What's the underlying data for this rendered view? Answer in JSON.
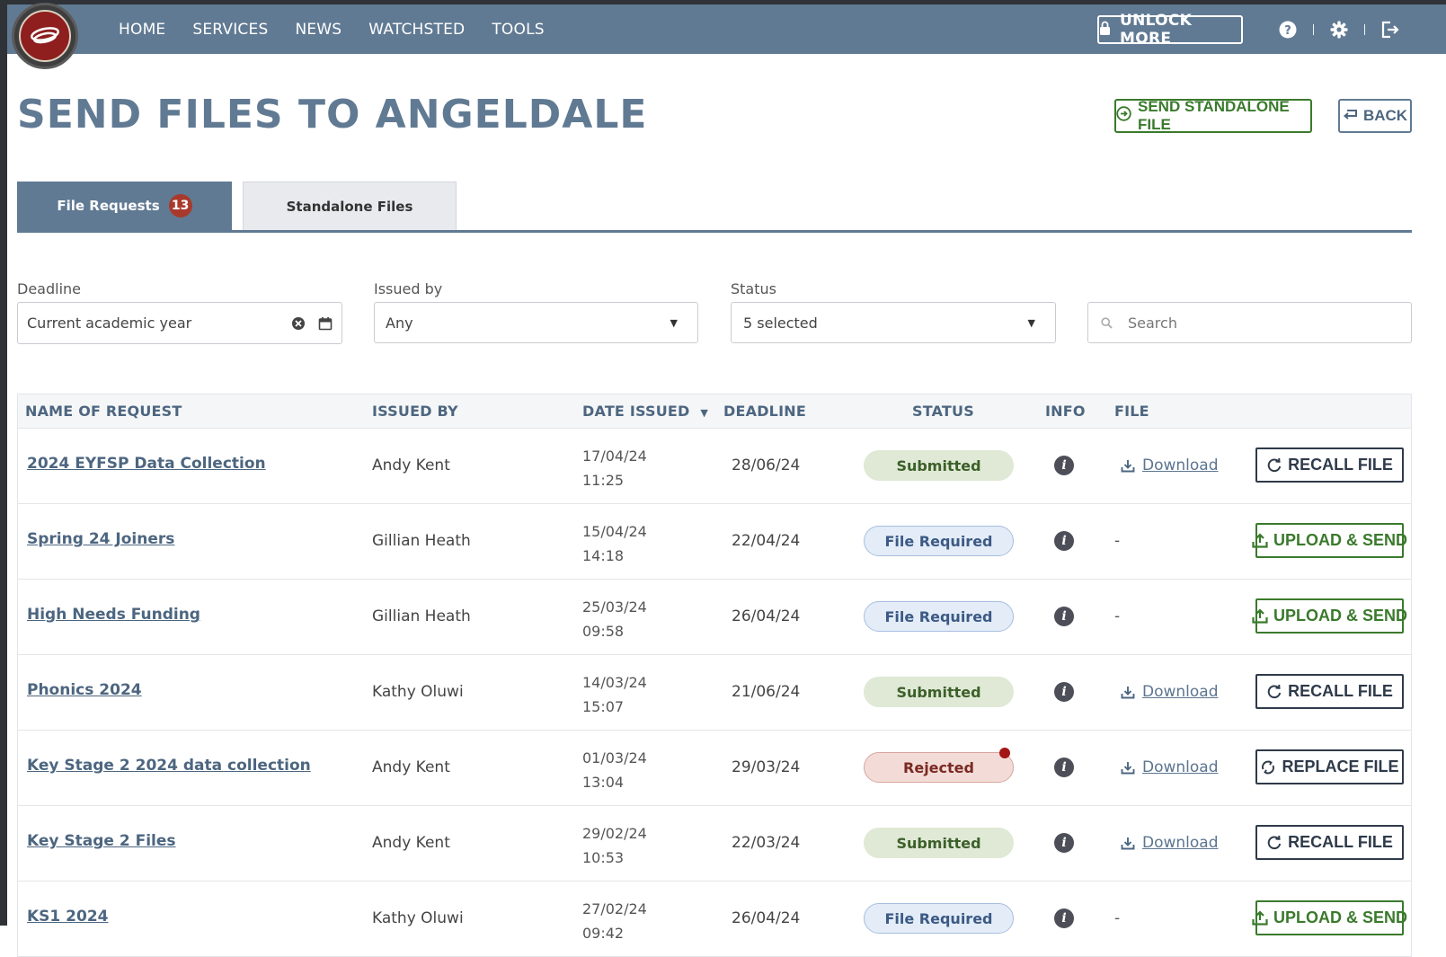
{
  "nav": {
    "links": [
      "HOME",
      "SERVICES",
      "NEWS",
      "WATCHSTED",
      "TOOLS"
    ],
    "unlock_label": "UNLOCK MORE"
  },
  "page": {
    "title": "SEND FILES TO ANGELDALE",
    "send_standalone_label": "SEND STANDALONE FILE",
    "back_label": "BACK"
  },
  "tabs": {
    "file_requests_label": "File Requests",
    "file_requests_count": "13",
    "standalone_label": "Standalone Files"
  },
  "filters": {
    "deadline_label": "Deadline",
    "deadline_value": "Current academic year",
    "issued_by_label": "Issued by",
    "issued_by_value": "Any",
    "status_label": "Status",
    "status_value": "5 selected",
    "search_placeholder": "Search"
  },
  "table": {
    "headers": {
      "name": "NAME OF REQUEST",
      "issued_by": "ISSUED BY",
      "date_issued": "DATE ISSUED",
      "sort_indicator": "▼",
      "deadline": "DEADLINE",
      "status": "STATUS",
      "info": "INFO",
      "file": "FILE"
    },
    "rows": [
      {
        "name": "2024 EYFSP Data Collection",
        "issued_by": "Andy Kent",
        "date": "17/04/24",
        "time": "11:25",
        "deadline": "28/06/24",
        "status": "Submitted",
        "status_type": "submitted",
        "file": "Download",
        "action": "RECALL FILE",
        "action_type": "recall"
      },
      {
        "name": "Spring 24 Joiners",
        "issued_by": "Gillian Heath",
        "date": "15/04/24",
        "time": "14:18",
        "deadline": "22/04/24",
        "status": "File Required",
        "status_type": "required",
        "file": "-",
        "action": "UPLOAD & SEND",
        "action_type": "upload"
      },
      {
        "name": "High Needs Funding",
        "issued_by": "Gillian Heath",
        "date": "25/03/24",
        "time": "09:58",
        "deadline": "26/04/24",
        "status": "File Required",
        "status_type": "required",
        "file": "-",
        "action": "UPLOAD & SEND",
        "action_type": "upload"
      },
      {
        "name": "Phonics 2024",
        "issued_by": "Kathy Oluwi",
        "date": "14/03/24",
        "time": "15:07",
        "deadline": "21/06/24",
        "status": "Submitted",
        "status_type": "submitted",
        "file": "Download",
        "action": "RECALL FILE",
        "action_type": "recall"
      },
      {
        "name": "Key Stage 2 2024 data collection",
        "issued_by": "Andy Kent",
        "date": "01/03/24",
        "time": "13:04",
        "deadline": "29/03/24",
        "status": "Rejected",
        "status_type": "rejected",
        "file": "Download",
        "action": "REPLACE FILE",
        "action_type": "replace"
      },
      {
        "name": "Key Stage 2 Files",
        "issued_by": "Andy Kent",
        "date": "29/02/24",
        "time": "10:53",
        "deadline": "22/03/24",
        "status": "Submitted",
        "status_type": "submitted",
        "file": "Download",
        "action": "RECALL FILE",
        "action_type": "recall"
      },
      {
        "name": "KS1 2024",
        "issued_by": "Kathy Oluwi",
        "date": "27/02/24",
        "time": "09:42",
        "deadline": "26/04/24",
        "status": "File Required",
        "status_type": "required",
        "file": "-",
        "action": "UPLOAD & SEND",
        "action_type": "upload"
      }
    ]
  },
  "colors": {
    "nav_bg": "#617a93",
    "brand_red": "#8f1e1e",
    "accent_green": "#3a7a2c",
    "badge_red": "#a83a2c"
  }
}
